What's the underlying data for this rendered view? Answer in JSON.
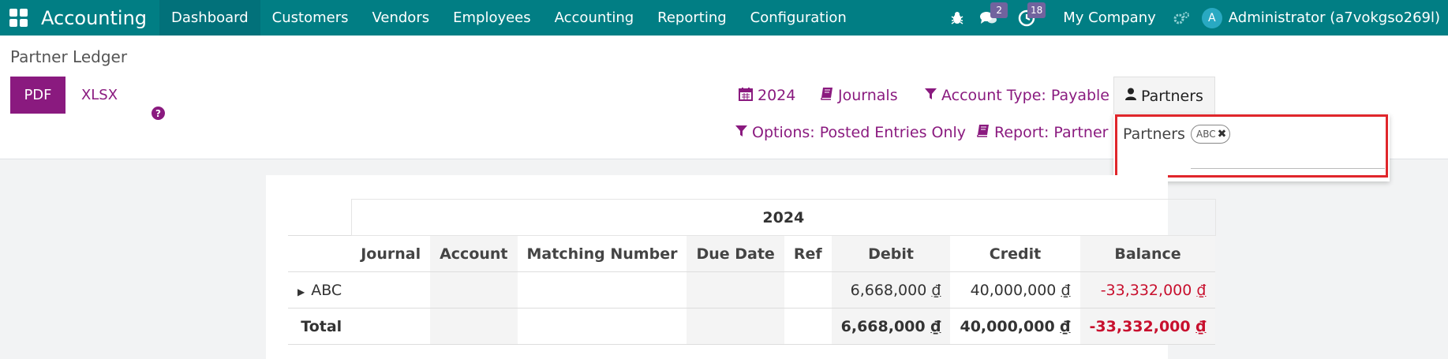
{
  "nav": {
    "brand": "Accounting",
    "items": [
      "Dashboard",
      "Customers",
      "Vendors",
      "Employees",
      "Accounting",
      "Reporting",
      "Configuration"
    ],
    "active": "Dashboard",
    "messages_count": "2",
    "activities_count": "18",
    "company": "My Company",
    "user_initial": "A",
    "user_name": "Administrator (a7vokgso269l)"
  },
  "control": {
    "breadcrumb": "Partner Ledger",
    "pdf_label": "PDF",
    "xlsx_label": "XLSX",
    "help_glyph": "?",
    "filters": {
      "date": "2024",
      "journals": "Journals",
      "account_type": "Account Type: Payable",
      "partners": "Partners",
      "options": "Options: Posted Entries Only",
      "report": "Report: Partner L"
    },
    "dropdown": {
      "label": "Partners",
      "tag": "ABC"
    }
  },
  "report": {
    "period": "2024",
    "columns": [
      "Journal",
      "Account",
      "Matching Number",
      "Due Date",
      "Ref",
      "Debit",
      "Credit",
      "Balance"
    ],
    "rows": [
      {
        "name": "ABC",
        "debit": "6,668,000",
        "credit": "40,000,000",
        "balance": "-33,332,000"
      }
    ],
    "total": {
      "name": "Total",
      "debit": "6,668,000",
      "credit": "40,000,000",
      "balance": "-33,332,000"
    },
    "currency_symbol": "₫"
  },
  "colors": {
    "nav_bg": "#017e84",
    "accent": "#8a1a7f",
    "negative": "#c8102e",
    "highlight_border": "#e0262b"
  }
}
